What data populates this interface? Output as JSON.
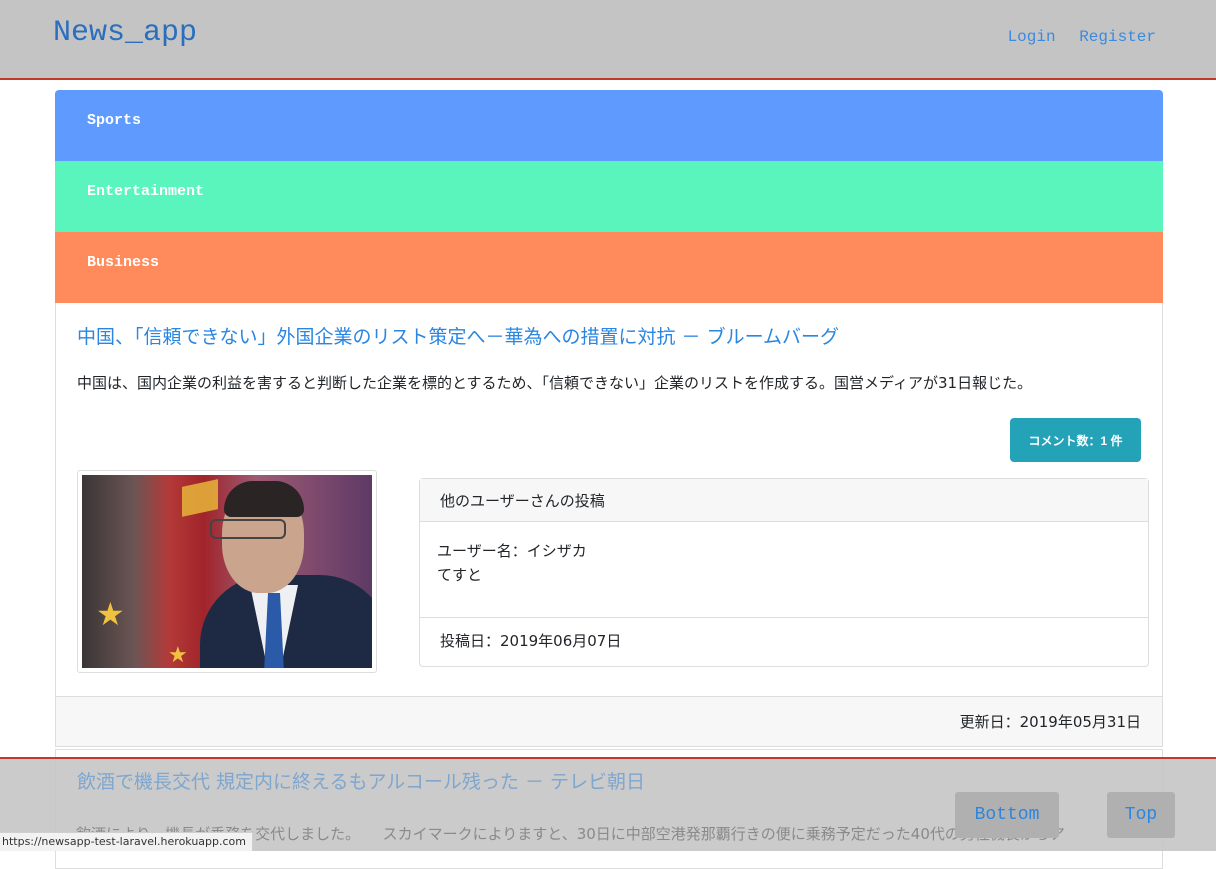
{
  "header": {
    "brand": "News_app",
    "login": "Login",
    "register": "Register"
  },
  "categories": [
    {
      "label": "Sports",
      "color": "#5f9bff"
    },
    {
      "label": "Entertainment",
      "color": "#5af5bd"
    },
    {
      "label": "Business",
      "color": "#ff8a5b"
    }
  ],
  "article": {
    "headline": "中国、「信頼できない」外国企業のリスト策定へ－華為への措置に対抗 － ブルームバーグ",
    "summary": "中国は、国内企業の利益を害すると判断した企業を標的とするため、「信頼できない」企業のリストを作成する。国営メディアが31日報じた。",
    "comment_button": "コメント数：1 件",
    "post": {
      "header": "他のユーザーさんの投稿",
      "username": "ユーザー名：イシザカ",
      "body": "てすと",
      "posted_date": "投稿日：2019年06月07日"
    },
    "updated_date": "更新日：2019年05月31日"
  },
  "next_article": {
    "headline": "飲酒で機長交代 規定内に終えるもアルコール残った － テレビ朝日",
    "summary": "飲酒により、機長が乗務を交代しました。　　スカイマークによりますと、30日に中部空港発那覇行きの便に乗務予定だった40代の男性機長からア"
  },
  "floating_buttons": {
    "bottom": "Bottom",
    "top": "Top"
  },
  "status_bar": "https://newsapp-test-laravel.herokuapp.com"
}
